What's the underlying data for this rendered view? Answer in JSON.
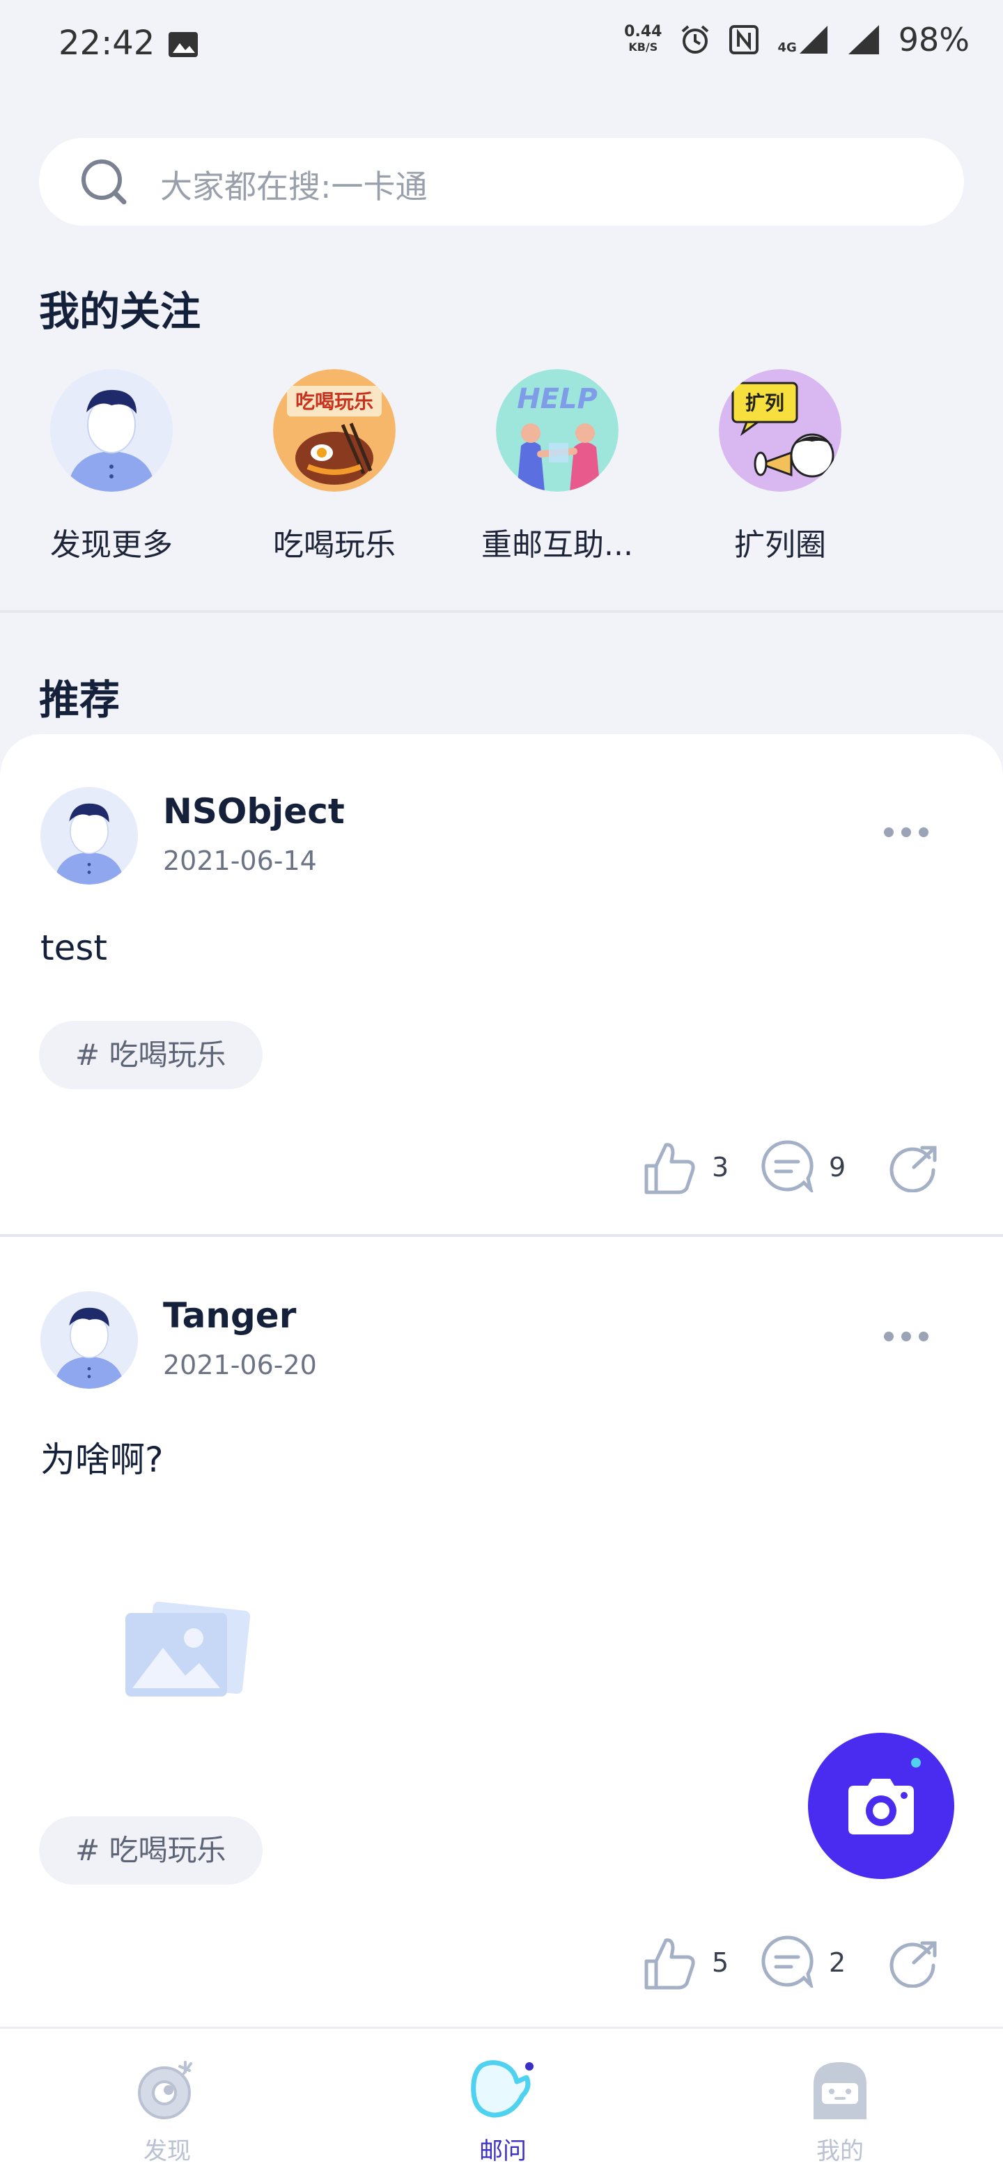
{
  "status_bar": {
    "time": "22:42",
    "net_speed": "0.44",
    "net_unit": "KB/S",
    "network": "4G",
    "battery": "98%"
  },
  "search": {
    "placeholder": "大家都在搜:一卡通"
  },
  "following": {
    "title": "我的关注",
    "items": [
      {
        "label": "发现更多",
        "icon": "avatar-icon"
      },
      {
        "label": "吃喝玩乐",
        "icon": "food-icon",
        "badge": "吃喝玩乐"
      },
      {
        "label": "重邮互助...",
        "icon": "help-icon",
        "badge": "HELP"
      },
      {
        "label": "扩列圈",
        "icon": "megaphone-icon",
        "badge": "扩列"
      }
    ]
  },
  "recommend": {
    "title": "推荐"
  },
  "posts": [
    {
      "author": "NSObject",
      "date": "2021-06-14",
      "content": "test",
      "tag": "# 吃喝玩乐",
      "likes": "3",
      "comments": "9"
    },
    {
      "author": "Tanger",
      "date": "2021-06-20",
      "content": "为啥啊?",
      "tag": "# 吃喝玩乐",
      "likes": "5",
      "comments": "2"
    }
  ],
  "bottom_nav": [
    {
      "label": "发现",
      "color": "#b9c1d2"
    },
    {
      "label": "邮问",
      "color": "#3a2fc7"
    },
    {
      "label": "我的",
      "color": "#b9c1d2"
    }
  ],
  "colors": {
    "accent": "#4a2cf0",
    "nav_active": "#4fd1f0"
  }
}
